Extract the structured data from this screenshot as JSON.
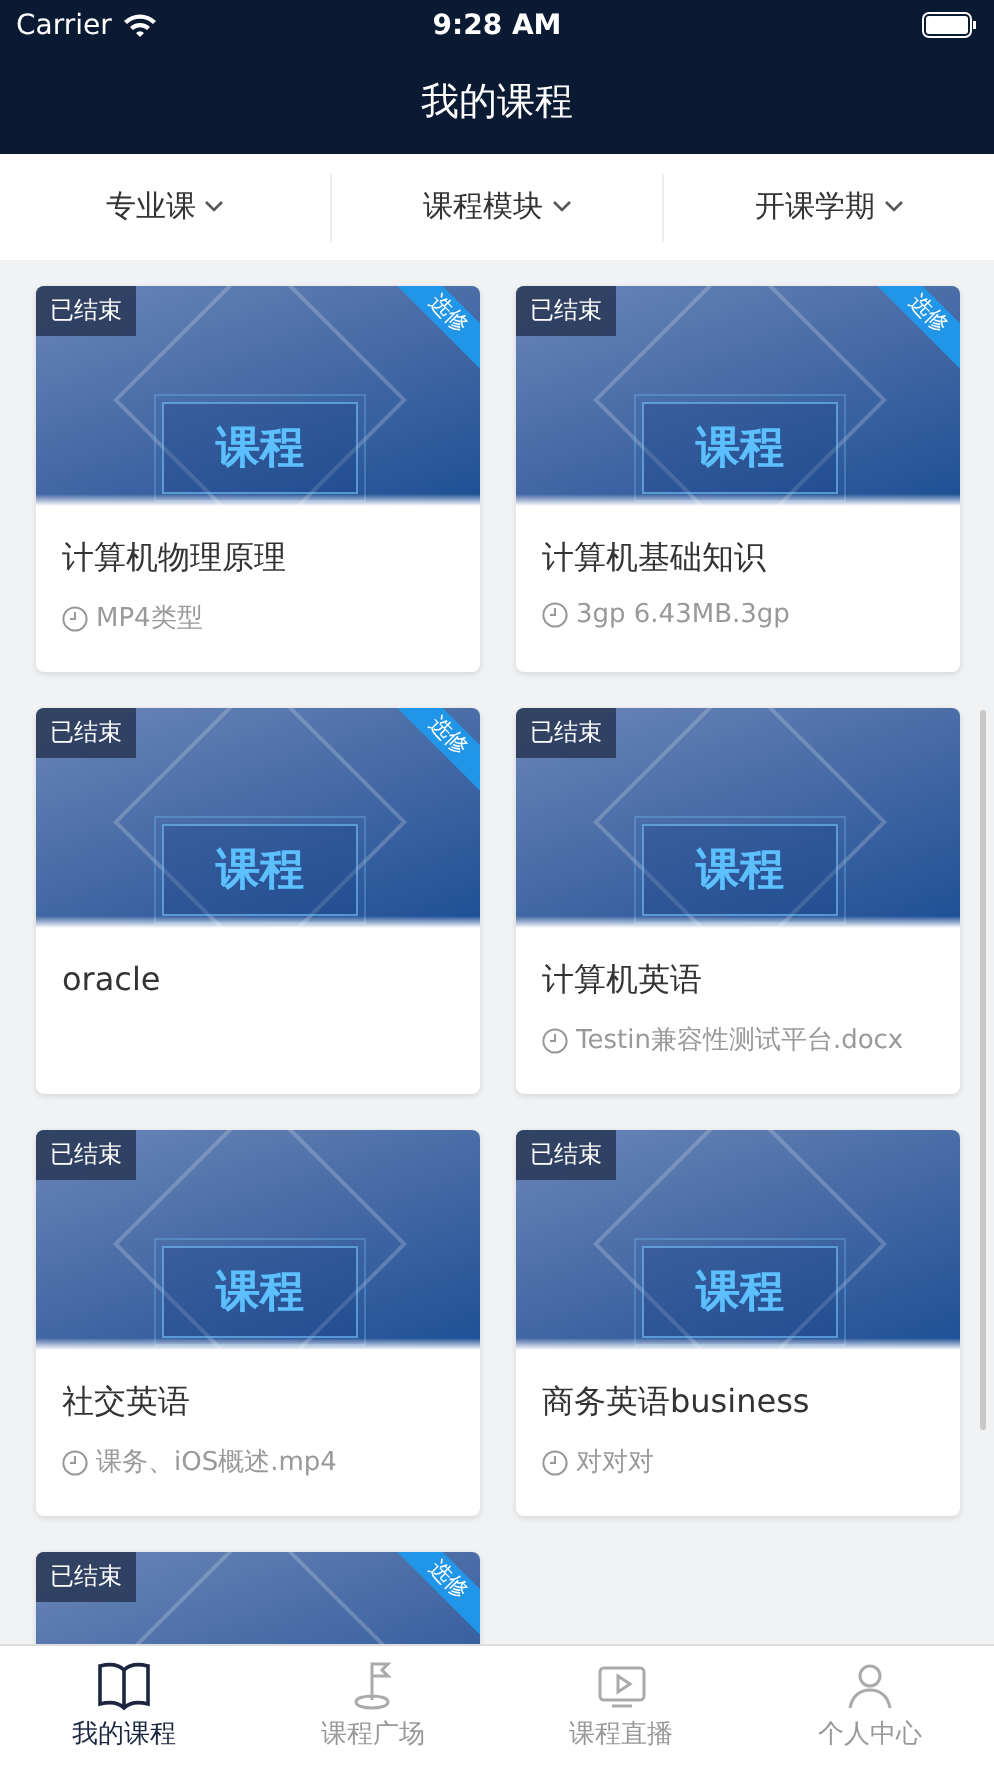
{
  "status_bar": {
    "carrier": "Carrier",
    "time": "9:28 AM"
  },
  "title": "我的课程",
  "filters": [
    {
      "label": "专业课"
    },
    {
      "label": "课程模块"
    },
    {
      "label": "开课学期"
    }
  ],
  "courses": [
    {
      "status": "已结束",
      "tag": "选修",
      "cover_label": "课程",
      "title": "计算机物理原理",
      "meta": "MP4类型"
    },
    {
      "status": "已结束",
      "tag": "选修",
      "cover_label": "课程",
      "title": "计算机基础知识",
      "meta": "3gp 6.43MB.3gp"
    },
    {
      "status": "已结束",
      "tag": "选修",
      "cover_label": "课程",
      "title": "oracle"
    },
    {
      "status": "已结束",
      "cover_label": "课程",
      "title": "计算机英语",
      "meta": "Testin兼容性测试平台.docx"
    },
    {
      "status": "已结束",
      "cover_label": "课程",
      "title": "社交英语",
      "meta": "课务、iOS概述.mp4"
    },
    {
      "status": "已结束",
      "cover_label": "课程",
      "title": "商务英语business",
      "meta": "对对对"
    },
    {
      "status": "已结束",
      "tag": "选修"
    }
  ],
  "tab_bar": [
    {
      "label": "我的课程",
      "kind": "book",
      "selected": true
    },
    {
      "label": "课程广场",
      "kind": "flag",
      "selected": false
    },
    {
      "label": "课程直播",
      "kind": "live",
      "selected": false
    },
    {
      "label": "个人中心",
      "kind": "person",
      "selected": false
    }
  ]
}
